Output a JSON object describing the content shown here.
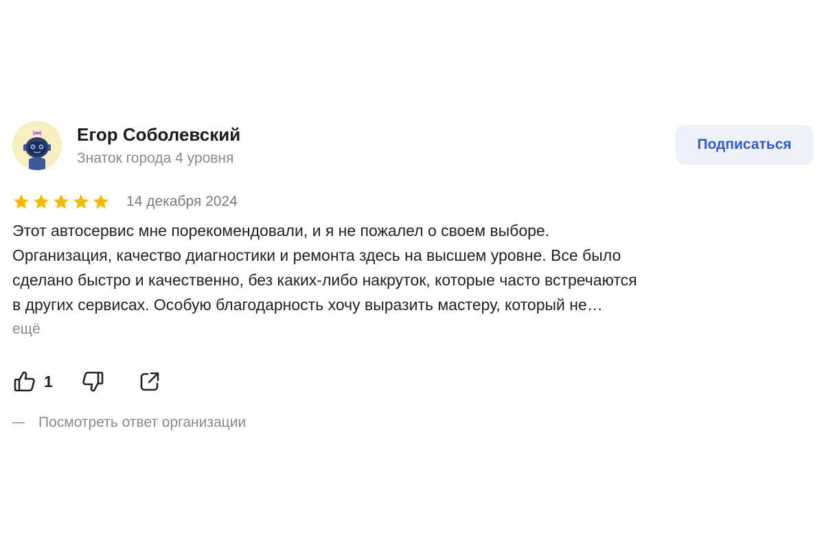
{
  "author": {
    "name": "Егор Соболевский",
    "level": "Знаток города 4 уровня",
    "avatar_icon": "robot-avatar-icon"
  },
  "subscribe_label": "Подписаться",
  "review": {
    "rating": 5,
    "rating_max": 5,
    "date": "14 декабря 2024",
    "text_lines": [
      "Этот автосервис мне порекомендовали, и я не пожалел о своем выборе.",
      "Организация, качество диагностики и ремонта здесь на высшем уровне. Все было",
      "сделано быстро и качественно, без каких-либо накруток, которые часто встречаются",
      "в других сервисах. Особую благодарность хочу выразить мастеру, который не…"
    ],
    "more_label": "ещё"
  },
  "actions": {
    "like_count": "1",
    "like_icon": "thumbs-up-icon",
    "dislike_icon": "thumbs-down-icon",
    "share_icon": "share-icon"
  },
  "org_reply_label": "Посмотреть ответ организации",
  "colors": {
    "star": "#f5b900",
    "accent": "#2f5bd1",
    "secondary_text": "#8a8a8a",
    "button_bg": "#eef1f7",
    "avatar_bg": "#f7efc0"
  }
}
